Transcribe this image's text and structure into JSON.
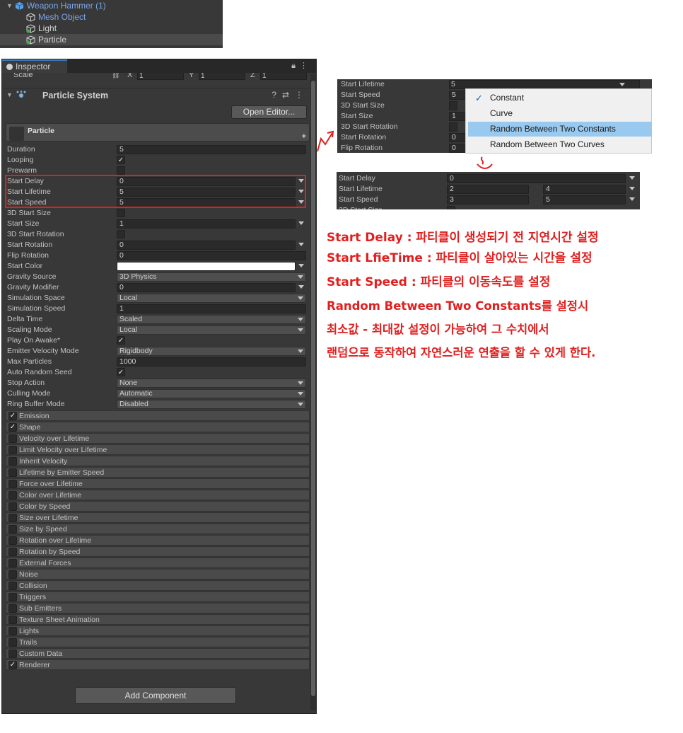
{
  "hierarchy": {
    "items": [
      {
        "label": "Weapon Hammer (1)",
        "color": "#7aa6e8",
        "indent": 0
      },
      {
        "label": "Mesh Object",
        "color": "#7aa6e8",
        "indent": 1
      },
      {
        "label": "Light",
        "color": "#d2d2d2",
        "indent": 1
      },
      {
        "label": "Particle",
        "color": "#d2d2d2",
        "indent": 1
      }
    ]
  },
  "inspector": {
    "tab_label": "Inspector",
    "scale": {
      "label": "Scale",
      "x_label": "X",
      "x": "1",
      "y_label": "Y",
      "y": "1",
      "z_label": "Z",
      "z": "1"
    },
    "component_title": "Particle System",
    "open_editor_label": "Open Editor...",
    "particle_name": "Particle",
    "properties": [
      {
        "label": "Duration",
        "value": "5",
        "kind": "text"
      },
      {
        "label": "Looping",
        "value": "✓",
        "kind": "check"
      },
      {
        "label": "Prewarm",
        "value": "",
        "kind": "check"
      },
      {
        "label": "Start Delay",
        "value": "0",
        "kind": "curve"
      },
      {
        "label": "Start Lifetime",
        "value": "5",
        "kind": "curve"
      },
      {
        "label": "Start Speed",
        "value": "5",
        "kind": "curve"
      },
      {
        "label": "3D Start Size",
        "value": "",
        "kind": "check"
      },
      {
        "label": "Start Size",
        "value": "1",
        "kind": "curve"
      },
      {
        "label": "3D Start Rotation",
        "value": "",
        "kind": "check"
      },
      {
        "label": "Start Rotation",
        "value": "0",
        "kind": "curve"
      },
      {
        "label": "Flip Rotation",
        "value": "0",
        "kind": "text"
      },
      {
        "label": "Start Color",
        "value": "",
        "kind": "color"
      },
      {
        "label": "Gravity Source",
        "value": "3D Physics",
        "kind": "dropdown"
      },
      {
        "label": "Gravity Modifier",
        "value": "0",
        "kind": "curve"
      },
      {
        "label": "Simulation Space",
        "value": "Local",
        "kind": "dropdown"
      },
      {
        "label": "Simulation Speed",
        "value": "1",
        "kind": "text"
      },
      {
        "label": "Delta Time",
        "value": "Scaled",
        "kind": "dropdown"
      },
      {
        "label": "Scaling Mode",
        "value": "Local",
        "kind": "dropdown"
      },
      {
        "label": "Play On Awake*",
        "value": "✓",
        "kind": "check"
      },
      {
        "label": "Emitter Velocity Mode",
        "value": "Rigidbody",
        "kind": "dropdown"
      },
      {
        "label": "Max Particles",
        "value": "1000",
        "kind": "text"
      },
      {
        "label": "Auto Random Seed",
        "value": "✓",
        "kind": "check"
      },
      {
        "label": "Stop Action",
        "value": "None",
        "kind": "dropdown"
      },
      {
        "label": "Culling Mode",
        "value": "Automatic",
        "kind": "dropdown"
      },
      {
        "label": "Ring Buffer Mode",
        "value": "Disabled",
        "kind": "dropdown"
      }
    ],
    "modules": [
      {
        "label": "Emission",
        "checked": "✓"
      },
      {
        "label": "Shape",
        "checked": "✓"
      },
      {
        "label": "Velocity over Lifetime",
        "checked": ""
      },
      {
        "label": "Limit Velocity over Lifetime",
        "checked": ""
      },
      {
        "label": "Inherit Velocity",
        "checked": ""
      },
      {
        "label": "Lifetime by Emitter Speed",
        "checked": ""
      },
      {
        "label": "Force over Lifetime",
        "checked": ""
      },
      {
        "label": "Color over Lifetime",
        "checked": ""
      },
      {
        "label": "Color by Speed",
        "checked": ""
      },
      {
        "label": "Size over Lifetime",
        "checked": ""
      },
      {
        "label": "Size by Speed",
        "checked": ""
      },
      {
        "label": "Rotation over Lifetime",
        "checked": ""
      },
      {
        "label": "Rotation by Speed",
        "checked": ""
      },
      {
        "label": "External Forces",
        "checked": ""
      },
      {
        "label": "Noise",
        "checked": ""
      },
      {
        "label": "Collision",
        "checked": ""
      },
      {
        "label": "Triggers",
        "checked": ""
      },
      {
        "label": "Sub Emitters",
        "checked": ""
      },
      {
        "label": "Texture Sheet Animation",
        "checked": ""
      },
      {
        "label": "Lights",
        "checked": ""
      },
      {
        "label": "Trails",
        "checked": ""
      },
      {
        "label": "Custom Data",
        "checked": ""
      },
      {
        "label": "Renderer",
        "checked": "✓"
      }
    ],
    "add_component_label": "Add Component"
  },
  "popup1": {
    "rows": [
      {
        "label": "Start Lifetime",
        "value": "5"
      },
      {
        "label": "Start Speed",
        "value": "5"
      },
      {
        "label": "3D Start Size",
        "value": ""
      },
      {
        "label": "Start Size",
        "value": "1"
      },
      {
        "label": "3D Start Rotation",
        "value": ""
      },
      {
        "label": "Start Rotation",
        "value": "0"
      },
      {
        "label": "Flip Rotation",
        "value": "0"
      }
    ],
    "menu": [
      {
        "label": "Constant",
        "checked": "✓"
      },
      {
        "label": "Curve",
        "checked": ""
      },
      {
        "label": "Random Between Two Constants",
        "checked": ""
      },
      {
        "label": "Random Between Two Curves",
        "checked": ""
      }
    ]
  },
  "popup2": {
    "rows": [
      {
        "label": "Start Delay",
        "min": "0",
        "max": ""
      },
      {
        "label": "Start Lifetime",
        "min": "2",
        "max": "4"
      },
      {
        "label": "Start Speed",
        "min": "3",
        "max": "5"
      },
      {
        "label": "3D Start Size",
        "min": "",
        "max": ""
      }
    ]
  },
  "notes": [
    "Start Delay : 파티클이 생성되기 전 지연시간 설정",
    "Start LfieTime : 파티클이 살아있는 시간을 설정",
    "Start Speed : 파티클의 이동속도를 설정",
    "Random Between Two Constants를 설정시",
    "최소값 - 최대값 설정이 가능하여 그 수치에서",
    "랜덤으로 동작하여 자연스러운 연출을 할 수 있게 한다."
  ],
  "colors": {
    "annotation": "#e02020",
    "highlight": "#99c9ef",
    "selection_blue": "#3a79bb"
  }
}
